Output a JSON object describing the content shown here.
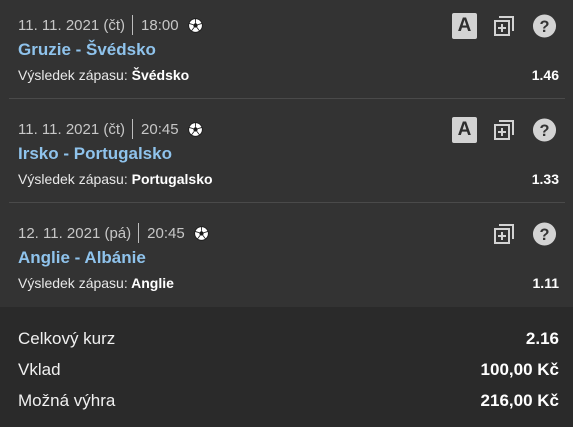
{
  "bets": [
    {
      "date": "11. 11. 2021 (čt)",
      "time": "18:00",
      "sport_icon": "soccer-ball-icon",
      "match": "Gruzie - Švédsko",
      "market_label": "Výsledek zápasu:",
      "selection": "Švédsko",
      "odds": "1.46",
      "letter_badge": "A",
      "icons": [
        "letter-a-icon",
        "add-copy-icon",
        "help-icon"
      ]
    },
    {
      "date": "11. 11. 2021 (čt)",
      "time": "20:45",
      "sport_icon": "soccer-ball-icon",
      "match": "Irsko - Portugalsko",
      "market_label": "Výsledek zápasu:",
      "selection": "Portugalsko",
      "odds": "1.33",
      "letter_badge": "A",
      "icons": [
        "letter-a-icon",
        "add-copy-icon",
        "help-icon"
      ]
    },
    {
      "date": "12. 11. 2021 (pá)",
      "time": "20:45",
      "sport_icon": "soccer-ball-icon",
      "match": "Anglie - Albánie",
      "market_label": "Výsledek zápasu:",
      "selection": "Anglie",
      "odds": "1.11",
      "icons": [
        "add-copy-icon",
        "help-icon"
      ]
    }
  ],
  "summary": {
    "total_odds_label": "Celkový kurz",
    "total_odds_value": "2.16",
    "stake_label": "Vklad",
    "stake_value": "100,00 Kč",
    "win_label": "Možná výhra",
    "win_value": "216,00 Kč"
  },
  "colors": {
    "background": "#313131",
    "summary_background": "#2a2a2a",
    "match_link": "#8fc3ec",
    "date_text": "#c7c7c7"
  }
}
